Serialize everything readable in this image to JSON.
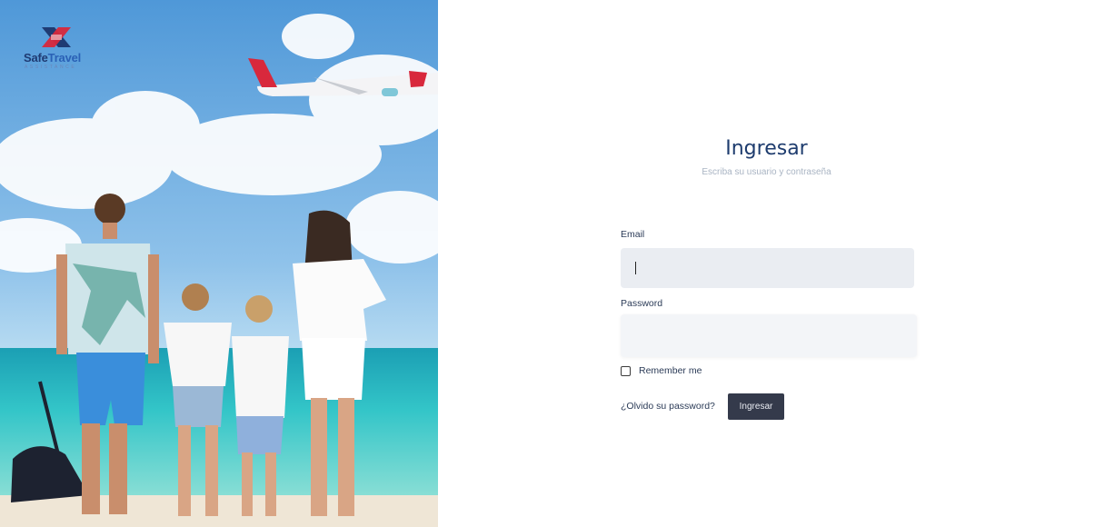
{
  "brand": {
    "name_part1": "Safe",
    "name_part2": "Travel",
    "tagline": "ASSISTANCE"
  },
  "login": {
    "title": "Ingresar",
    "subtitle": "Escriba su usuario y contraseña",
    "email_label": "Email",
    "email_value": "",
    "password_label": "Password",
    "password_value": "",
    "remember_label": "Remember me",
    "remember_checked": false,
    "forgot_link": "¿Olvido su password?",
    "submit_label": "Ingresar"
  },
  "colors": {
    "primary_text": "#1e3c6e",
    "button_bg": "#343a4b",
    "input_bg": "#eaedf2"
  }
}
